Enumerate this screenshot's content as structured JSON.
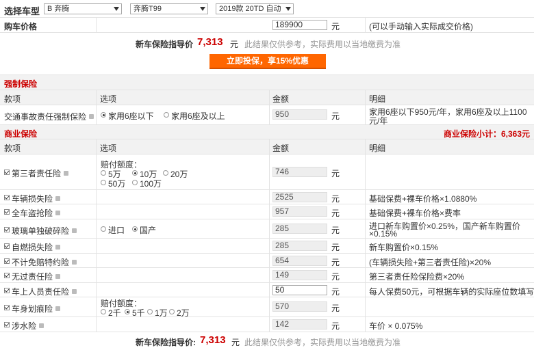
{
  "header": {
    "select_label": "选择车型",
    "brand": "B 奔腾",
    "series": "奔腾T99",
    "model": "2019款 20TD 自动",
    "price_label": "购车价格",
    "price_value": "189900",
    "unit": "元",
    "price_hint": "(可以手动输入实际成交价格)"
  },
  "guide": {
    "label": "新车保险指导价",
    "label_colon": "新车保险指导价:",
    "amount": "7,313",
    "unit": "元",
    "note": "此结果仅供参考，实际费用以当地缴费为准",
    "button": "立即投保，享15%优惠"
  },
  "columns": {
    "item": "款项",
    "option": "选项",
    "amount": "金额",
    "detail": "明细"
  },
  "compulsory": {
    "title": "强制保险",
    "item": "交通事故责任强制保险",
    "opt1": "家用6座以下",
    "opt2": "家用6座及以上",
    "amount": "950",
    "detail_line1": "家用6座以下950元/年，家用6座及以上1100",
    "detail_line2": "元/年"
  },
  "commercial": {
    "title": "商业保险",
    "subtotal": "商业保险小计：6,363元",
    "third_party": {
      "name": "第三者责任险",
      "quota_label": "赔付额度：",
      "opts": [
        "5万",
        "10万",
        "20万",
        "50万",
        "100万"
      ],
      "amount": "746"
    },
    "vehicle_loss": {
      "name": "车辆损失险",
      "amount": "2525",
      "detail": "基础保费+裸车价格×1.0880%"
    },
    "theft": {
      "name": "全车盗抢险",
      "amount": "957",
      "detail": "基础保费+裸车价格×费率"
    },
    "glass": {
      "name": "玻璃单独破碎险",
      "opt1": "进口",
      "opt2": "国产",
      "amount": "285",
      "detail_line1": "进口新车购置价×0.25%，国产新车购置价",
      "detail_line2": "×0.15%"
    },
    "fire": {
      "name": "自燃损失险",
      "amount": "285",
      "detail": "新车购置价×0.15%"
    },
    "deductible": {
      "name": "不计免赔特约险",
      "amount": "654",
      "detail": "(车辆损失险+第三者责任险)×20%"
    },
    "no_fault": {
      "name": "无过责任险",
      "amount": "149",
      "detail": "第三者责任险保险费×20%"
    },
    "passenger": {
      "name": "车上人员责任险",
      "amount": "50",
      "detail": "每人保费50元，可根据车辆的实际座位数填写"
    },
    "scratch": {
      "name": "车身划痕险",
      "quota_label": "赔付额度：",
      "opts": [
        "2千",
        "5千",
        "1万",
        "2万"
      ],
      "amount": "570"
    },
    "water": {
      "name": "涉水险",
      "amount": "142",
      "detail": "车价 × 0.075%"
    }
  }
}
